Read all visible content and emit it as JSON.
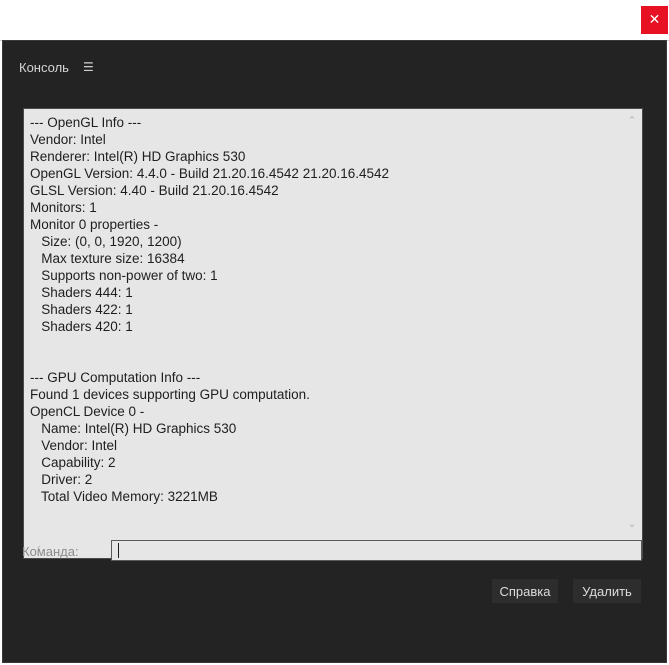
{
  "window": {
    "close_glyph": "✕"
  },
  "panel": {
    "title": "Консоль",
    "menu_glyph": "☰"
  },
  "console": {
    "lines": [
      "--- OpenGL Info ---",
      "Vendor: Intel",
      "Renderer: Intel(R) HD Graphics 530",
      "OpenGL Version: 4.4.0 - Build 21.20.16.4542 21.20.16.4542",
      "GLSL Version: 4.40 - Build 21.20.16.4542",
      "Monitors: 1",
      "Monitor 0 properties -",
      "   Size: (0, 0, 1920, 1200)",
      "   Max texture size: 16384",
      "   Supports non-power of two: 1",
      "   Shaders 444: 1",
      "   Shaders 422: 1",
      "   Shaders 420: 1",
      "",
      "",
      "--- GPU Computation Info ---",
      "Found 1 devices supporting GPU computation.",
      "OpenCL Device 0 -",
      "   Name: Intel(R) HD Graphics 530",
      "   Vendor: Intel",
      "   Capability: 2",
      "   Driver: 2",
      "   Total Video Memory: 3221MB"
    ],
    "scroll_up_glyph": "⌃",
    "scroll_down_glyph": "⌄",
    "scroll_left_glyph": "‹",
    "scroll_right_glyph": "›"
  },
  "command": {
    "label": "Команда:",
    "value": ""
  },
  "buttons": {
    "help": "Справка",
    "delete": "Удалить"
  },
  "colors": {
    "panel_bg": "#232323",
    "console_bg": "#e6e6e6",
    "close_button_bg": "#e81123"
  }
}
